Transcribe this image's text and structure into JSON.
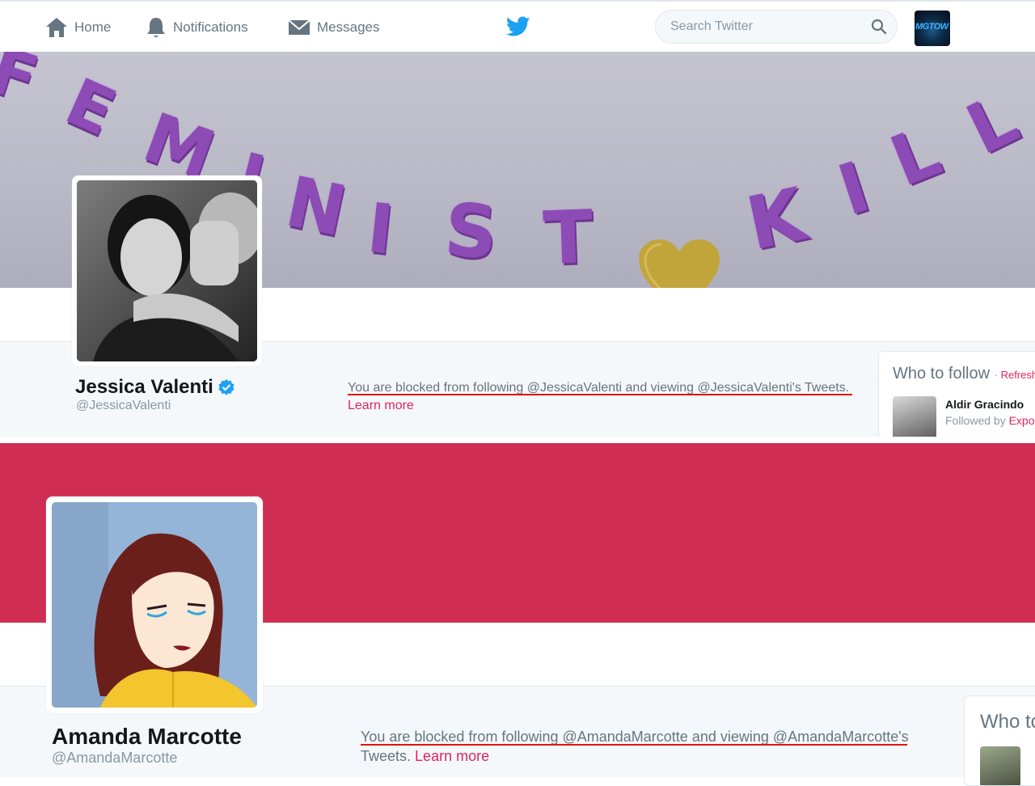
{
  "nav": {
    "home_label": "Home",
    "notifications_label": "Notifications",
    "messages_label": "Messages",
    "search_placeholder": "Search Twitter",
    "account_avatar_text": "MGTOW",
    "accent_color": "#1da1f2"
  },
  "profiles": [
    {
      "banner_text": "FEMINIST",
      "banner_text_2": "KILL",
      "name": "Jessica Valenti",
      "verified": true,
      "handle": "@JessicaValenti",
      "blocked_message": "You are blocked from following @JessicaValenti and viewing @JessicaValenti's Tweets.",
      "learn_more": "Learn more",
      "who_to_follow": {
        "title": "Who to follow",
        "refresh": "Refresh",
        "suggestion_name": "Aldir Gracindo",
        "followed_by_prefix": "Followed by",
        "followed_by_name": "Expo"
      }
    },
    {
      "banner_color": "#d02d53",
      "name": "Amanda Marcotte",
      "handle": "@AmandaMarcotte",
      "blocked_message_line1": "You are blocked from following @AmandaMarcotte and viewing @AmandaMarcotte's",
      "blocked_message_line2": "Tweets.",
      "learn_more": "Learn more",
      "who_to_follow": {
        "title": "Who to"
      }
    }
  ]
}
